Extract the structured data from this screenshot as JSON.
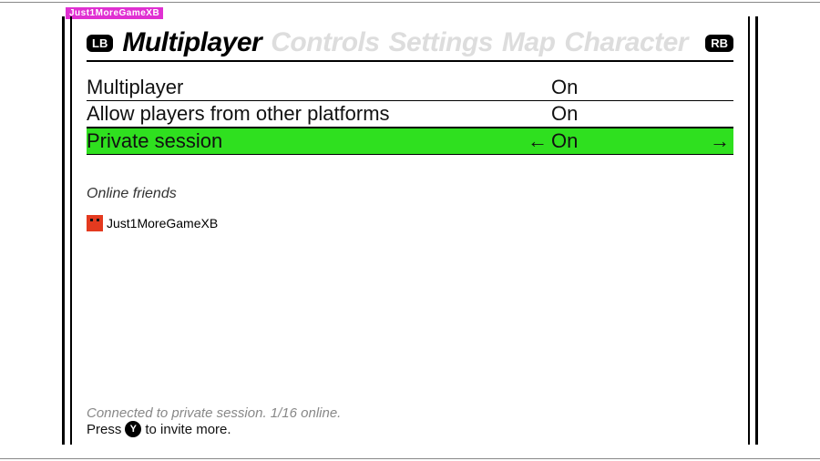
{
  "watermark": "Just1MoreGameXB",
  "bumpers": {
    "left": "LB",
    "right": "RB"
  },
  "tabs": {
    "active": "Multiplayer",
    "inactive": [
      "Controls",
      "Settings",
      "Map",
      "Character"
    ]
  },
  "settings": [
    {
      "label": "Multiplayer",
      "value": "On",
      "selected": false
    },
    {
      "label": "Allow players from other platforms",
      "value": "On",
      "selected": false
    },
    {
      "label": "Private session",
      "value": "On",
      "selected": true
    }
  ],
  "friends": {
    "title": "Online friends",
    "list": [
      {
        "name": "Just1MoreGameXB"
      }
    ]
  },
  "footer": {
    "status": "Connected to private session. 1/16 online.",
    "prompt_pre": "Press",
    "prompt_button": "Y",
    "prompt_post": "to invite more."
  },
  "arrows": {
    "left": "←",
    "right": "→"
  }
}
